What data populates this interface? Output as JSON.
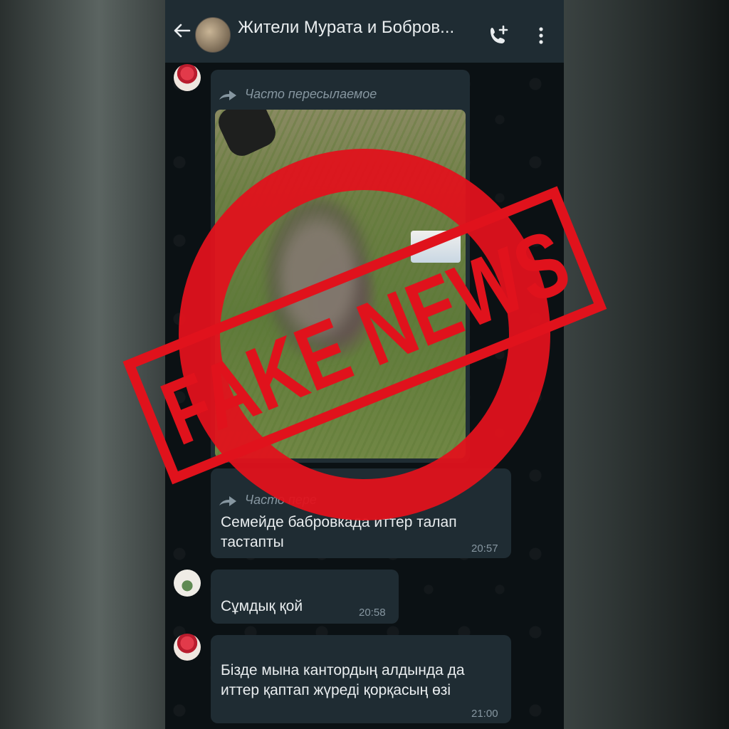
{
  "header": {
    "title": "Жители Мурата и Бобров...",
    "back_icon": "arrow-left-icon",
    "call_icon": "add-call-icon",
    "menu_icon": "more-vertical-icon"
  },
  "messages": [
    {
      "forwarded_label": "Часто пересылаемое",
      "type": "image"
    },
    {
      "forwarded_label": "Часто пере",
      "text_line1": "Семейде бабровкада иттер талап",
      "text_line2": "тастапты",
      "time": "20:57"
    },
    {
      "text": "Сұмдық қой",
      "time": "20:58"
    },
    {
      "text_line1": "Бізде мына кантордың алдында да",
      "text_line2": "иттер қаптап жүреді қорқасың өзі",
      "time": "21:00"
    }
  ],
  "stamp": {
    "text": "FAKE NEWS",
    "color": "#e0121c"
  },
  "colors": {
    "header_bg": "#1f2c33",
    "bubble_bg": "#1f2c33",
    "chat_bg": "#0b1114",
    "meta_text": "#8696a0"
  }
}
